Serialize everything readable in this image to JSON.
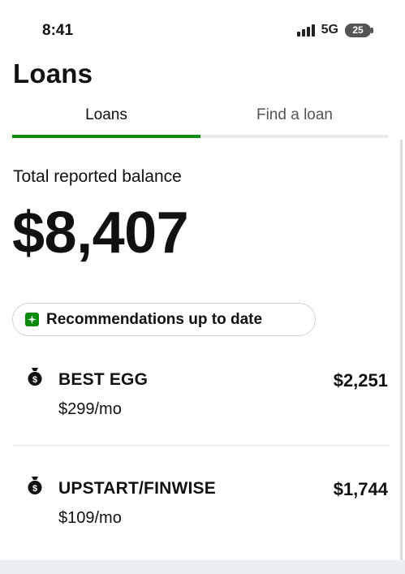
{
  "status_bar": {
    "time": "8:41",
    "network": "5G",
    "battery": "25"
  },
  "header": {
    "title": "Loans"
  },
  "tabs": [
    {
      "label": "Loans",
      "active": true
    },
    {
      "label": "Find a loan",
      "active": false
    }
  ],
  "balance": {
    "label": "Total reported balance",
    "amount": "$8,407"
  },
  "recommendations": {
    "label": "Recommendations up to date",
    "icon": "sparkle-icon"
  },
  "loans": [
    {
      "name": "BEST EGG",
      "payment": "$299/mo",
      "amount": "$2,251",
      "icon": "money-bag-icon"
    },
    {
      "name": "UPSTART/FINWISE",
      "payment": "$109/mo",
      "amount": "$1,744",
      "icon": "money-bag-icon"
    }
  ],
  "colors": {
    "accent": "#0a8a0a",
    "text": "#111111",
    "muted": "#555555",
    "divider": "#dfe2e5"
  }
}
